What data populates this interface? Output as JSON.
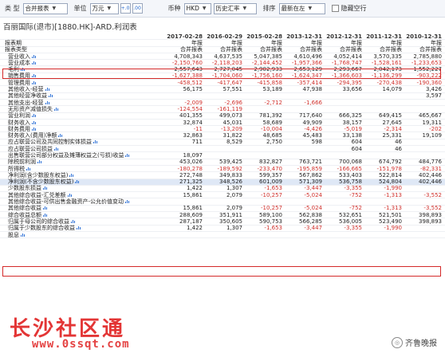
{
  "toolbar": {
    "type_label": "类 型",
    "type_value": "合并报表",
    "unit_label": "单位",
    "unit_value": "万元",
    "currency_label": "币种",
    "currency_value": "HKD",
    "rate_value": "历史汇率",
    "sort_label": "排序",
    "sort_value": "最新在左",
    "hide_empty_label": "隐藏空行"
  },
  "page_title": "百丽国际(退市)[1880.HK]-ARD.利润表",
  "columns": [
    "2017-02-28",
    "2016-02-29",
    "2015-02-28",
    "2013-12-31",
    "2012-12-31",
    "2011-12-31",
    "2010-12-31"
  ],
  "header_rows": [
    {
      "label": "报表期",
      "values": [
        "年报",
        "年报",
        "年报",
        "年报",
        "年报",
        "年报",
        "年报"
      ]
    },
    {
      "label": "报表类型",
      "values": [
        "合并报表",
        "合并报表",
        "合并报表",
        "合并报表",
        "合并报表",
        "合并报表",
        "合并报表"
      ]
    }
  ],
  "rows": [
    {
      "label": "营业收入",
      "values": [
        "4,708,343",
        "4,637,535",
        "5,047,385",
        "4,610,496",
        "4,052,414",
        "3,570,335",
        "2,785,880"
      ]
    },
    {
      "label": "营业成本",
      "values": [
        "-2,150,760",
        "-2,118,203",
        "-2,144,452",
        "-1,957,366",
        "-1,768,747",
        "-1,528,161",
        "-1,233,653"
      ]
    },
    {
      "label": "毛利",
      "values": [
        "2,557,643",
        "2,727,045",
        "2,902,933",
        "2,653,129",
        "2,293,667",
        "2,042,173",
        "1,552,227"
      ]
    },
    {
      "label": "销售费用",
      "values": [
        "-1,627,388",
        "-1,704,060",
        "-1,756,160",
        "-1,624,347",
        "-1,366,603",
        "-1,136,299",
        "-903,222"
      ]
    },
    {
      "label": "管理费用",
      "values": [
        "-458,512",
        "-417,647",
        "-415,858",
        "-357,414",
        "-294,395",
        "-270,438",
        "-190,360"
      ]
    },
    {
      "label": "其他收入-经营",
      "values": [
        "56,175",
        "57,551",
        "53,189",
        "47,938",
        "33,656",
        "14,079",
        "3,426"
      ]
    },
    {
      "label": "其他经营净收益",
      "values": [
        "",
        "",
        "",
        "",
        "",
        "",
        "3,597"
      ]
    },
    {
      "label": "其他支出-经营",
      "values": [
        "-2,009",
        "-2,696",
        "-2,712",
        "-1,666",
        "",
        "",
        ""
      ]
    },
    {
      "label": "无形资产减值损失",
      "values": [
        "-124,554",
        "-161,119",
        "",
        "",
        "",
        "",
        ""
      ]
    },
    {
      "label": "营业利润",
      "values": [
        "401,355",
        "499,073",
        "781,392",
        "717,640",
        "666,325",
        "649,415",
        "465,667"
      ]
    },
    {
      "label": "财务收入",
      "values": [
        "32,874",
        "45,031",
        "58,689",
        "49,909",
        "38,157",
        "27,645",
        "19,311"
      ]
    },
    {
      "label": "财务费用",
      "values": [
        "-11",
        "-13,209",
        "-10,004",
        "-4,426",
        "-5,019",
        "-2,314",
        "-202"
      ]
    },
    {
      "label": "财务收入(费用)净额",
      "values": [
        "32,863",
        "31,822",
        "48,685",
        "45,483",
        "33,138",
        "25,331",
        "19,109"
      ]
    },
    {
      "label": "应占联营公司及共同控制实体损益",
      "values": [
        "711",
        "8,529",
        "2,750",
        "598",
        "604",
        "46",
        ""
      ]
    },
    {
      "label": "应占联营公司损益",
      "values": [
        "",
        "",
        "",
        "",
        "604",
        "46",
        ""
      ]
    },
    {
      "label": "出售联营公司部分权益及摊薄权益之(亏损)收益",
      "values": [
        "18,097",
        "",
        "",
        "",
        "",
        "",
        ""
      ]
    },
    {
      "label": "除税前利润",
      "values": [
        "453,026",
        "539,425",
        "832,827",
        "763,721",
        "700,068",
        "674,792",
        "484,776"
      ]
    },
    {
      "label": "所得税",
      "values": [
        "-180,278",
        "-189,592",
        "-233,470",
        "-195,859",
        "-166,665",
        "-151,978",
        "-82,331"
      ]
    },
    {
      "label": "净利润(含少数股东权益)",
      "values": [
        "272,748",
        "349,833",
        "599,357",
        "567,862",
        "533,403",
        "522,814",
        "402,446"
      ]
    },
    {
      "label": "净利润(不含少数股东权益)",
      "values": [
        "271,325",
        "348,526",
        "601,009",
        "571,309",
        "536,758",
        "524,804",
        "402,446"
      ]
    },
    {
      "label": "少数股东损益",
      "values": [
        "1,422",
        "1,307",
        "-1,653",
        "-3,447",
        "-3,355",
        "-1,990",
        ""
      ]
    },
    {
      "label": "其他综合收益-汇兑差额",
      "values": [
        "15,861",
        "2,079",
        "-10,257",
        "-5,024",
        "-752",
        "-1,313",
        "-3,552"
      ]
    },
    {
      "label": "其他综合收益-可供出售金融资产-公允价值变动",
      "values": [
        "",
        "",
        "",
        "",
        "",
        "",
        ""
      ]
    },
    {
      "label": "其他综合收益",
      "values": [
        "15,861",
        "2,079",
        "-10,257",
        "-5,024",
        "-752",
        "-1,313",
        "-3,552"
      ]
    },
    {
      "label": "综合收益总额",
      "values": [
        "288,609",
        "351,911",
        "589,100",
        "562,838",
        "532,651",
        "521,501",
        "398,893"
      ]
    },
    {
      "label": "归属于母公司的综合收益",
      "values": [
        "287,187",
        "350,605",
        "590,753",
        "566,285",
        "536,005",
        "523,490",
        "398,893"
      ]
    },
    {
      "label": "归属于少数股东的综合收益",
      "values": [
        "1,422",
        "1,307",
        "-1,653",
        "-3,447",
        "-3,355",
        "-1,990",
        ""
      ]
    },
    {
      "label": "股息",
      "values": [
        "",
        "",
        "",
        "",
        "",
        "",
        ""
      ]
    }
  ],
  "watermark_cn": "长沙社区通",
  "watermark_url": "www.0ssqt.com",
  "logo_text": "齐鲁晚报",
  "colors": {
    "negative": "#d0312d",
    "highlight": "#d42a2a",
    "spark": "#2b6fd6"
  }
}
